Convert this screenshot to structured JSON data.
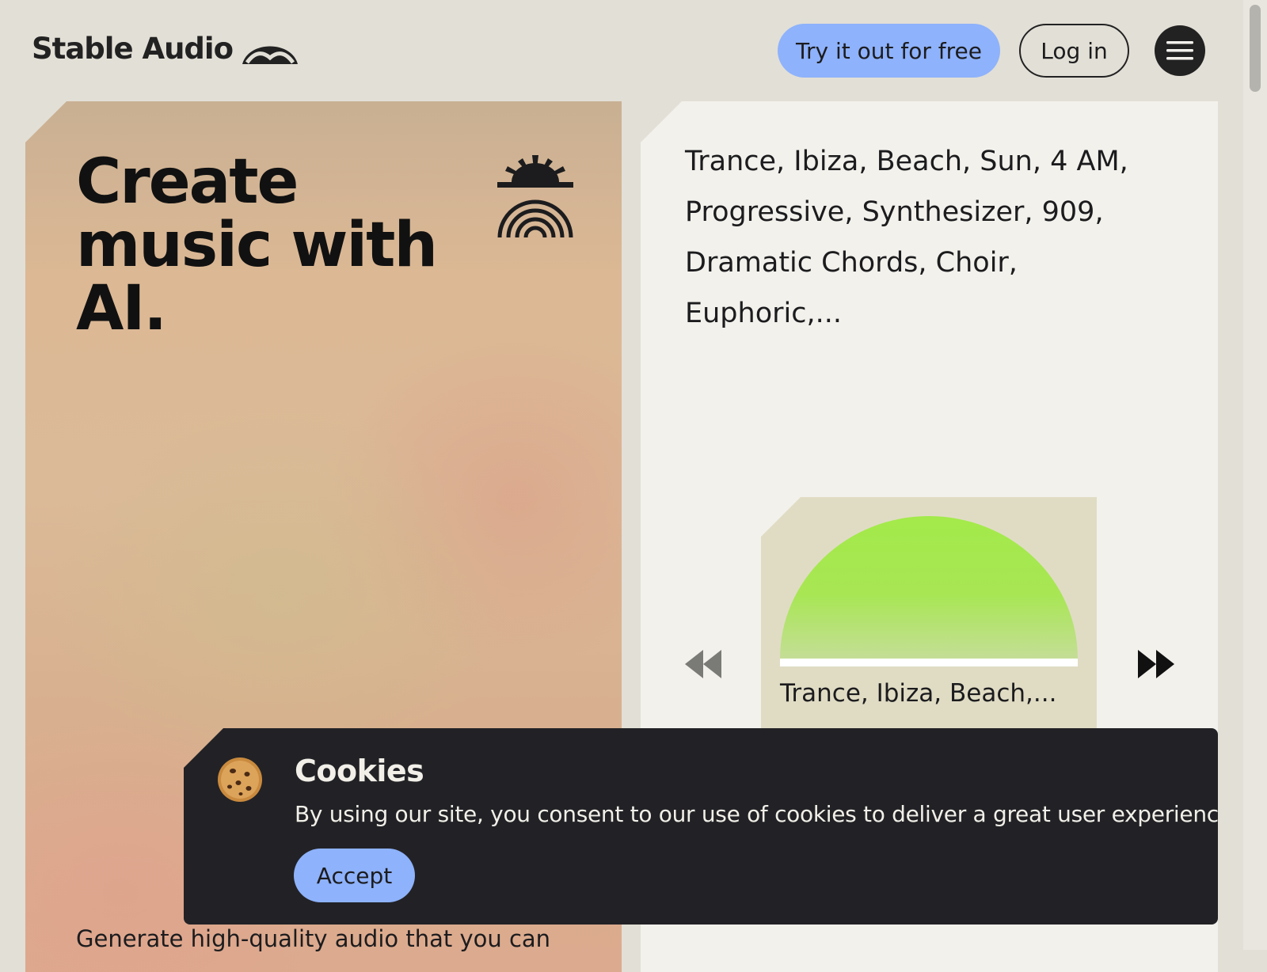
{
  "header": {
    "logo_text": "Stable Audio",
    "try_button": "Try it out for free",
    "login_button": "Log in",
    "menu_icon": "hamburger-menu-icon"
  },
  "hero": {
    "title": "Create music with AI.",
    "icon": "sun-rainbow-icon",
    "subtitle": "Generate high-quality audio that you can"
  },
  "player": {
    "prompt": "Trance, Ibiza, Beach, Sun, 4 AM, Progressive, Synthesizer, 909, Dramatic Chords, Choir, Euphoric,...",
    "track_title": "Trance, Ibiza, Beach,...",
    "prev_icon": "rewind-icon",
    "next_icon": "fast-forward-icon",
    "progress": 0
  },
  "cookie_banner": {
    "icon": "cookie-icon",
    "title": "Cookies",
    "text": "By using our site, you consent to our use of cookies to deliver a great user experience.",
    "accept_button": "Accept"
  },
  "colors": {
    "accent_blue": "#8eb2fb",
    "background": "#e2dfd6",
    "dark": "#222226",
    "dome_green": "#a3ea4a"
  }
}
